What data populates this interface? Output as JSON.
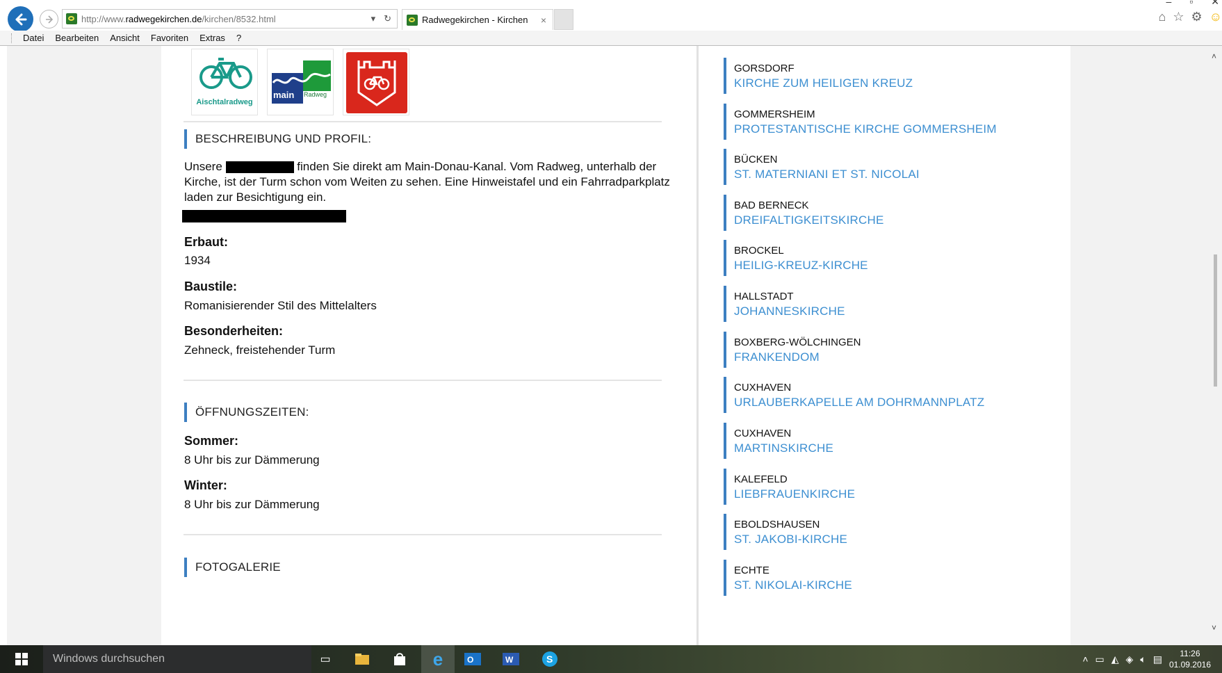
{
  "browser": {
    "url_prefix": "http://www.",
    "url_domain": "radwegekirchen.de",
    "url_path": "/kirchen/8532.html",
    "tab_title": "Radwegekirchen - Kirchen",
    "tab_close": "×",
    "menu": [
      "Datei",
      "Bearbeiten",
      "Ansicht",
      "Favoriten",
      "Extras",
      "?"
    ]
  },
  "content": {
    "logos": [
      {
        "caption": "Aischtalradweg"
      },
      {
        "caption": "main",
        "caption2": "Radweg"
      },
      {
        "caption": ""
      }
    ],
    "section_description": "BESCHREIBUNG UND PROFIL:",
    "description_before": "Unsere",
    "description_after": "finden Sie direkt am Main-Donau-Kanal. Vom Radweg, unterhalb der Kirche, ist der Turm schon vom Weiten zu sehen. Eine Hinweistafel und ein Fahrradparkplatz laden zur Besichtigung ein.",
    "built_label": "Erbaut:",
    "built_value": "1934",
    "style_label": "Baustile:",
    "style_value": "Romanisierender Stil des Mittelalters",
    "special_label": "Besonderheiten:",
    "special_value": "Zehneck, freistehender Turm",
    "section_hours": "ÖFFNUNGSZEITEN:",
    "summer_label": "Sommer:",
    "summer_value": "8 Uhr bis zur Dämmerung",
    "winter_label": "Winter:",
    "winter_value": "8 Uhr bis zur Dämmerung",
    "section_gallery": "FOTOGALERIE"
  },
  "sidebar": {
    "churches": [
      {
        "place": "GORSDORF",
        "name": "KIRCHE ZUM HEILIGEN KREUZ"
      },
      {
        "place": "GOMMERSHEIM",
        "name": "PROTESTANTISCHE KIRCHE GOMMERSHEIM"
      },
      {
        "place": "BÜCKEN",
        "name": "ST. MATERNIANI ET ST. NICOLAI"
      },
      {
        "place": "BAD BERNECK",
        "name": "DREIFALTIGKEITSKIRCHE"
      },
      {
        "place": "BROCKEL",
        "name": "HEILIG-KREUZ-KIRCHE"
      },
      {
        "place": "HALLSTADT",
        "name": "JOHANNESKIRCHE"
      },
      {
        "place": "BOXBERG-WÖLCHINGEN",
        "name": "FRANKENDOM"
      },
      {
        "place": "CUXHAVEN",
        "name": "URLAUBERKAPELLE AM DOHRMANNPLATZ"
      },
      {
        "place": "CUXHAVEN",
        "name": "MARTINSKIRCHE"
      },
      {
        "place": "KALEFELD",
        "name": "LIEBFRAUENKIRCHE"
      },
      {
        "place": "EBOLDSHAUSEN",
        "name": "ST. JAKOBI-KIRCHE"
      },
      {
        "place": "ECHTE",
        "name": "ST. NIKOLAI-KIRCHE"
      }
    ]
  },
  "taskbar": {
    "search_placeholder": "Windows durchsuchen",
    "time": "11:26",
    "date": "01.09.2016"
  },
  "colors": {
    "accent": "#3d7fc1",
    "link": "#3d8fd1",
    "ie_blue": "#1f6fb9"
  }
}
